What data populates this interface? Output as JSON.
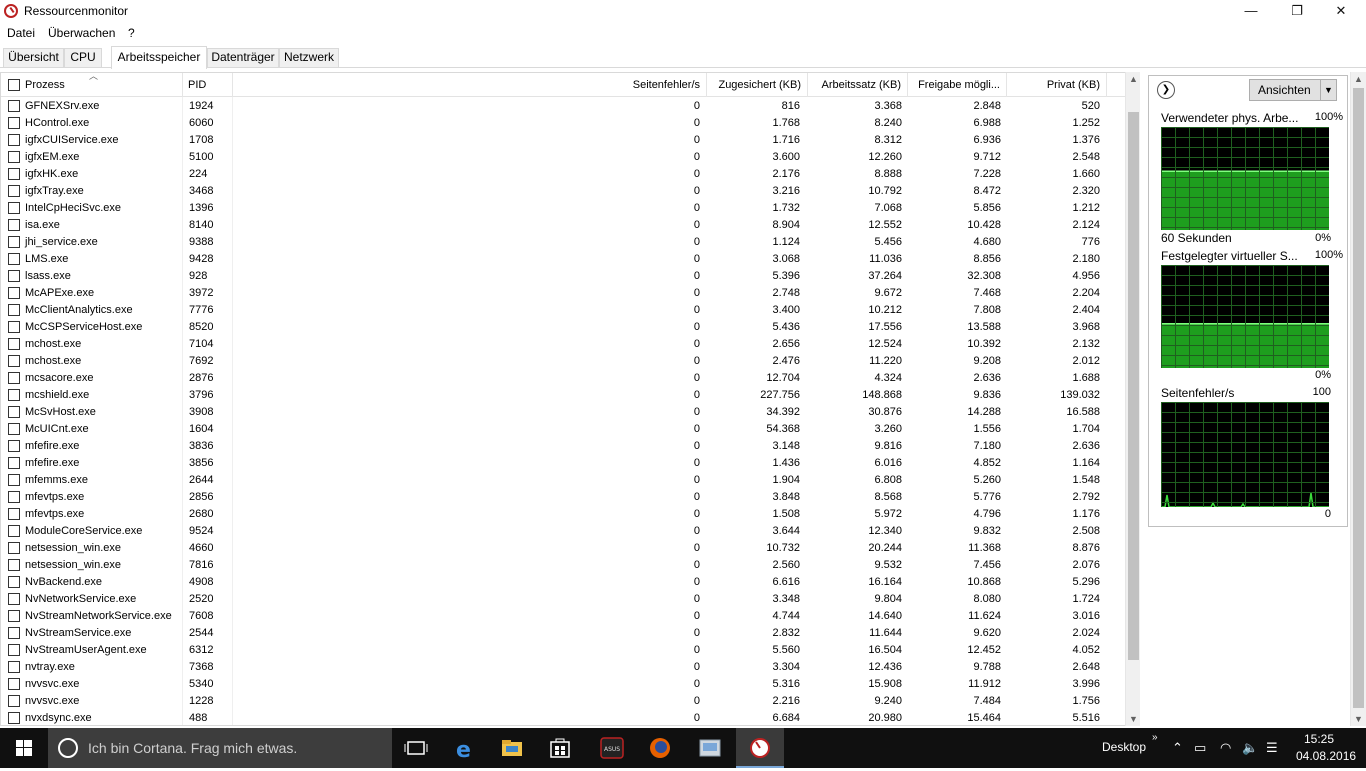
{
  "window": {
    "title": "Ressourcenmonitor",
    "minimize": "—",
    "maximize": "❐",
    "close": "✕"
  },
  "menu": [
    "Datei",
    "Überwachen",
    "?"
  ],
  "tabs": [
    "Übersicht",
    "CPU",
    "Arbeitsspeicher",
    "Datenträger",
    "Netzwerk"
  ],
  "active_tab": "Arbeitsspeicher",
  "table": {
    "columns": [
      "Prozess",
      "PID",
      "Seitenfehler/s",
      "Zugesichert (KB)",
      "Arbeitssatz (KB)",
      "Freigabe mögli...",
      "Privat (KB)"
    ],
    "rows": [
      [
        "GFNEXSrv.exe",
        "1924",
        "0",
        "816",
        "3.368",
        "2.848",
        "520"
      ],
      [
        "HControl.exe",
        "6060",
        "0",
        "1.768",
        "8.240",
        "6.988",
        "1.252"
      ],
      [
        "igfxCUIService.exe",
        "1708",
        "0",
        "1.716",
        "8.312",
        "6.936",
        "1.376"
      ],
      [
        "igfxEM.exe",
        "5100",
        "0",
        "3.600",
        "12.260",
        "9.712",
        "2.548"
      ],
      [
        "igfxHK.exe",
        "224",
        "0",
        "2.176",
        "8.888",
        "7.228",
        "1.660"
      ],
      [
        "igfxTray.exe",
        "3468",
        "0",
        "3.216",
        "10.792",
        "8.472",
        "2.320"
      ],
      [
        "IntelCpHeciSvc.exe",
        "1396",
        "0",
        "1.732",
        "7.068",
        "5.856",
        "1.212"
      ],
      [
        "isa.exe",
        "8140",
        "0",
        "8.904",
        "12.552",
        "10.428",
        "2.124"
      ],
      [
        "jhi_service.exe",
        "9388",
        "0",
        "1.124",
        "5.456",
        "4.680",
        "776"
      ],
      [
        "LMS.exe",
        "9428",
        "0",
        "3.068",
        "11.036",
        "8.856",
        "2.180"
      ],
      [
        "lsass.exe",
        "928",
        "0",
        "5.396",
        "37.264",
        "32.308",
        "4.956"
      ],
      [
        "McAPExe.exe",
        "3972",
        "0",
        "2.748",
        "9.672",
        "7.468",
        "2.204"
      ],
      [
        "McClientAnalytics.exe",
        "7776",
        "0",
        "3.400",
        "10.212",
        "7.808",
        "2.404"
      ],
      [
        "McCSPServiceHost.exe",
        "8520",
        "0",
        "5.436",
        "17.556",
        "13.588",
        "3.968"
      ],
      [
        "mchost.exe",
        "7104",
        "0",
        "2.656",
        "12.524",
        "10.392",
        "2.132"
      ],
      [
        "mchost.exe",
        "7692",
        "0",
        "2.476",
        "11.220",
        "9.208",
        "2.012"
      ],
      [
        "mcsacore.exe",
        "2876",
        "0",
        "12.704",
        "4.324",
        "2.636",
        "1.688"
      ],
      [
        "mcshield.exe",
        "3796",
        "0",
        "227.756",
        "148.868",
        "9.836",
        "139.032"
      ],
      [
        "McSvHost.exe",
        "3908",
        "0",
        "34.392",
        "30.876",
        "14.288",
        "16.588"
      ],
      [
        "McUICnt.exe",
        "1604",
        "0",
        "54.368",
        "3.260",
        "1.556",
        "1.704"
      ],
      [
        "mfefire.exe",
        "3836",
        "0",
        "3.148",
        "9.816",
        "7.180",
        "2.636"
      ],
      [
        "mfefire.exe",
        "3856",
        "0",
        "1.436",
        "6.016",
        "4.852",
        "1.164"
      ],
      [
        "mfemms.exe",
        "2644",
        "0",
        "1.904",
        "6.808",
        "5.260",
        "1.548"
      ],
      [
        "mfevtps.exe",
        "2856",
        "0",
        "3.848",
        "8.568",
        "5.776",
        "2.792"
      ],
      [
        "mfevtps.exe",
        "2680",
        "0",
        "1.508",
        "5.972",
        "4.796",
        "1.176"
      ],
      [
        "ModuleCoreService.exe",
        "9524",
        "0",
        "3.644",
        "12.340",
        "9.832",
        "2.508"
      ],
      [
        "netsession_win.exe",
        "4660",
        "0",
        "10.732",
        "20.244",
        "11.368",
        "8.876"
      ],
      [
        "netsession_win.exe",
        "7816",
        "0",
        "2.560",
        "9.532",
        "7.456",
        "2.076"
      ],
      [
        "NvBackend.exe",
        "4908",
        "0",
        "6.616",
        "16.164",
        "10.868",
        "5.296"
      ],
      [
        "NvNetworkService.exe",
        "2520",
        "0",
        "3.348",
        "9.804",
        "8.080",
        "1.724"
      ],
      [
        "NvStreamNetworkService.exe",
        "7608",
        "0",
        "4.744",
        "14.640",
        "11.624",
        "3.016"
      ],
      [
        "NvStreamService.exe",
        "2544",
        "0",
        "2.832",
        "11.644",
        "9.620",
        "2.024"
      ],
      [
        "NvStreamUserAgent.exe",
        "6312",
        "0",
        "5.560",
        "16.504",
        "12.452",
        "4.052"
      ],
      [
        "nvtray.exe",
        "7368",
        "0",
        "3.304",
        "12.436",
        "9.788",
        "2.648"
      ],
      [
        "nvvsvc.exe",
        "5340",
        "0",
        "5.316",
        "15.908",
        "11.912",
        "3.996"
      ],
      [
        "nvvsvc.exe",
        "1228",
        "0",
        "2.216",
        "9.240",
        "7.484",
        "1.756"
      ],
      [
        "nvxdsync.exe",
        "488",
        "0",
        "6.684",
        "20.980",
        "15.464",
        "5.516"
      ]
    ]
  },
  "side_panel": {
    "views_button": "Ansichten",
    "graphs": [
      {
        "title": "Verwendeter phys. Arbe...",
        "max": "100%",
        "bottom_left": "60 Sekunden",
        "min": "0%",
        "level": 0.57
      },
      {
        "title": "Festgelegter virtueller S...",
        "max": "100%",
        "bottom_left": "",
        "min": "0%",
        "level": 0.43
      },
      {
        "title": "Seitenfehler/s",
        "max": "100",
        "bottom_left": "",
        "min": "0",
        "level": 0.0
      }
    ]
  },
  "taskbar": {
    "cortana_text": "Ich bin Cortana. Frag mich etwas.",
    "desktop_label": "Desktop",
    "time": "15:25",
    "date": "04.08.2016",
    "accent": "#7aa7d8"
  }
}
